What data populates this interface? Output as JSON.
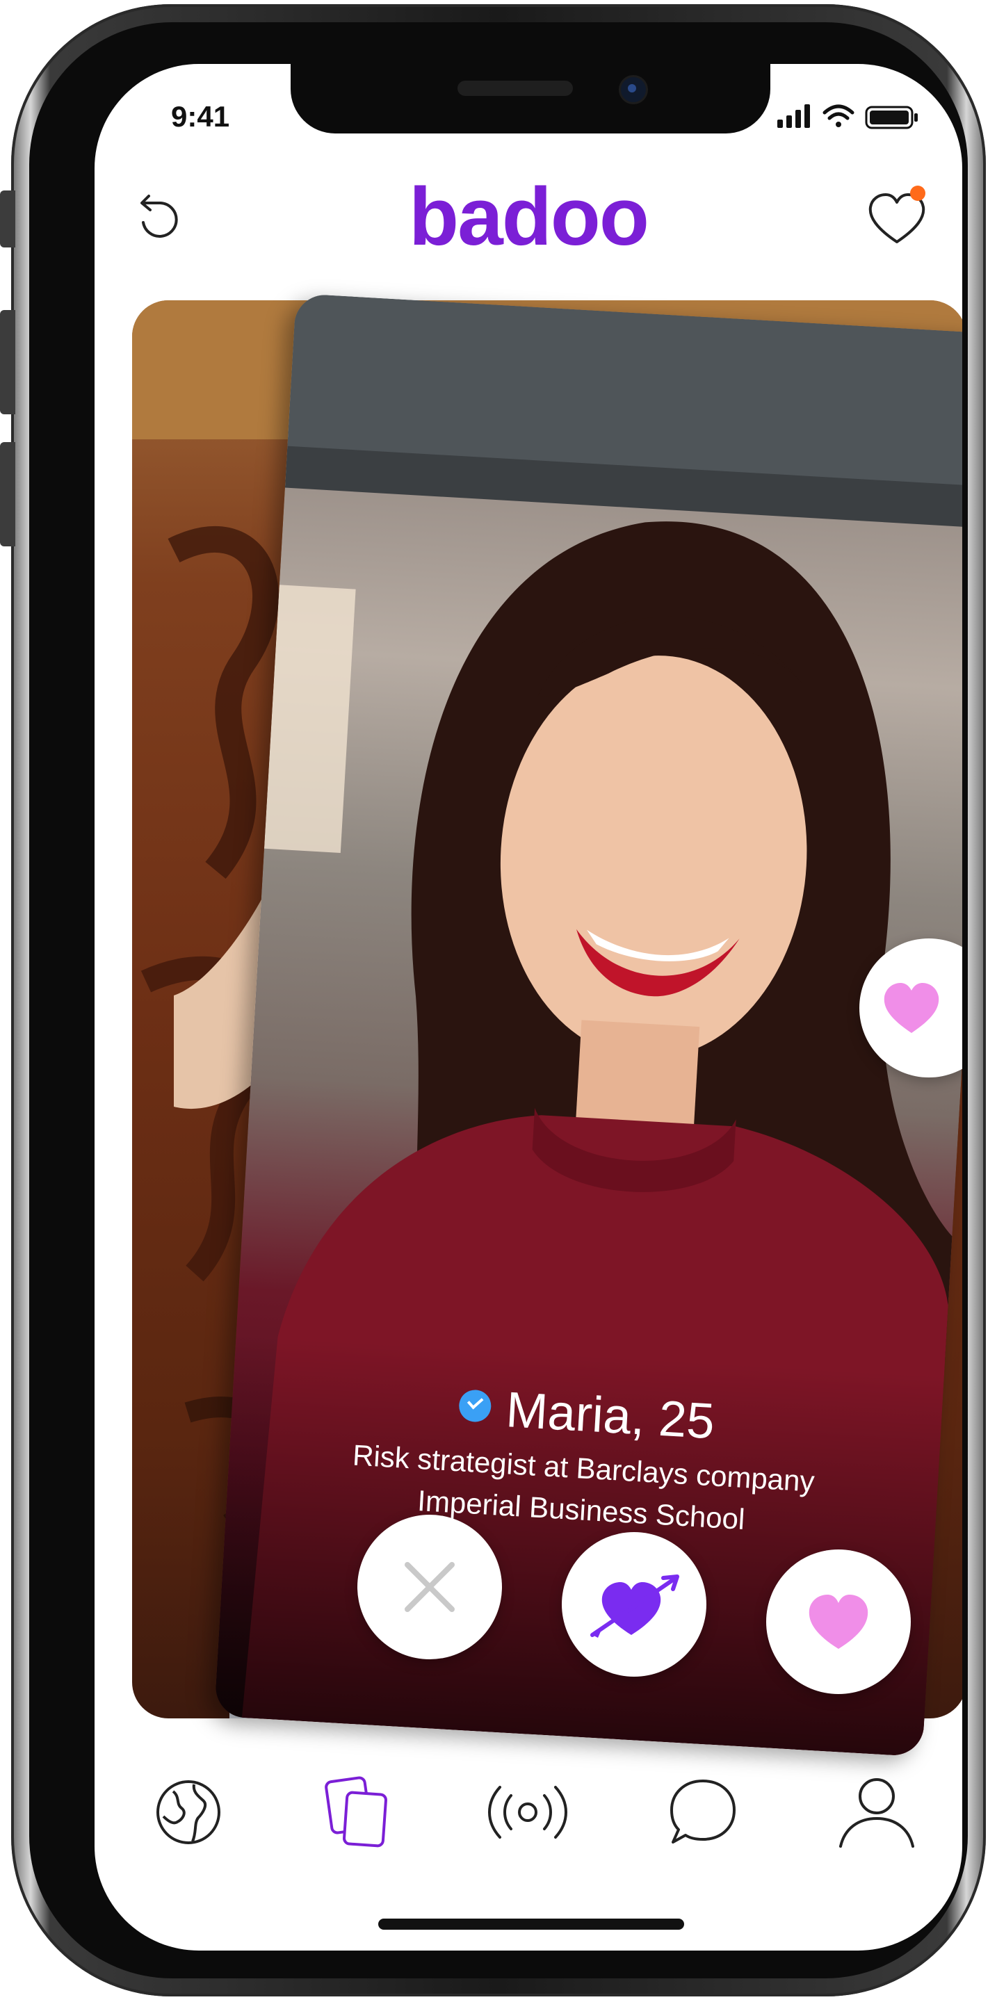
{
  "status_bar": {
    "time": "9:41"
  },
  "header": {
    "logo": "badoo",
    "undo_icon": "undo-icon",
    "likes_icon": "heart-notification-icon"
  },
  "profile": {
    "name_age": "Maria, 25",
    "job": "Risk strategist at Barclays company",
    "school": "Imperial Business School",
    "verified_icon": "verified-check-icon"
  },
  "actions": [
    {
      "id": "dislike",
      "icon": "close-icon"
    },
    {
      "id": "crush",
      "icon": "heart-arrow-icon"
    },
    {
      "id": "like",
      "icon": "heart-icon"
    }
  ],
  "bottom_nav": [
    {
      "id": "people-nearby",
      "icon": "globe-icon",
      "active": false
    },
    {
      "id": "encounters",
      "icon": "cards-icon",
      "active": true
    },
    {
      "id": "live",
      "icon": "broadcast-icon",
      "active": false
    },
    {
      "id": "chats",
      "icon": "chat-bubble-icon",
      "active": false
    },
    {
      "id": "profile",
      "icon": "user-icon",
      "active": false
    }
  ],
  "colors": {
    "brand": "#7b1fd6",
    "like": "#f08ee8",
    "crush": "#7a2cf0",
    "verified": "#3aa0f5",
    "notification_dot": "#ff6a1a"
  }
}
